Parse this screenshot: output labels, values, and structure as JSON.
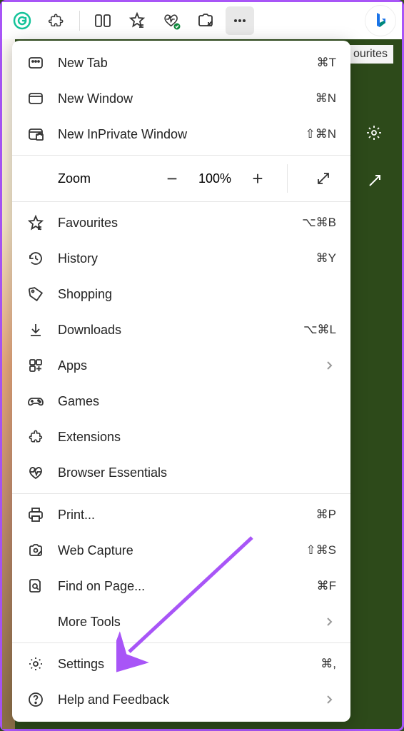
{
  "toolbar": {
    "favourites_label": "ourites"
  },
  "menu": {
    "new_tab": {
      "label": "New Tab",
      "shortcut": "⌘T"
    },
    "new_window": {
      "label": "New Window",
      "shortcut": "⌘N"
    },
    "new_inprivate": {
      "label": "New InPrivate Window",
      "shortcut": "⇧⌘N"
    },
    "zoom": {
      "label": "Zoom",
      "value": "100%"
    },
    "favourites": {
      "label": "Favourites",
      "shortcut": "⌥⌘B"
    },
    "history": {
      "label": "History",
      "shortcut": "⌘Y"
    },
    "shopping": {
      "label": "Shopping"
    },
    "downloads": {
      "label": "Downloads",
      "shortcut": "⌥⌘L"
    },
    "apps": {
      "label": "Apps"
    },
    "games": {
      "label": "Games"
    },
    "extensions": {
      "label": "Extensions"
    },
    "browser_essentials": {
      "label": "Browser Essentials"
    },
    "print": {
      "label": "Print...",
      "shortcut": "⌘P"
    },
    "web_capture": {
      "label": "Web Capture",
      "shortcut": "⇧⌘S"
    },
    "find": {
      "label": "Find on Page...",
      "shortcut": "⌘F"
    },
    "more_tools": {
      "label": "More Tools"
    },
    "settings": {
      "label": "Settings",
      "shortcut": "⌘,"
    },
    "help": {
      "label": "Help and Feedback"
    }
  }
}
